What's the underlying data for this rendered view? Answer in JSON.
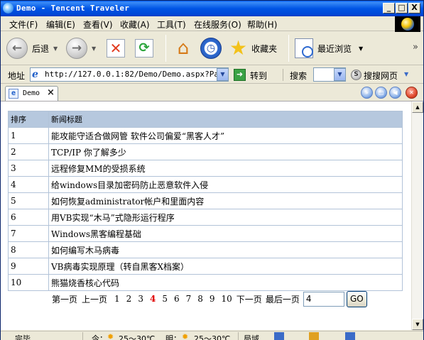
{
  "window": {
    "title": "Demo - Tencent Traveler",
    "min": "_",
    "max": "□",
    "close": "X"
  },
  "menu": [
    "文件(F)",
    "编辑(E)",
    "查看(V)",
    "收藏(A)",
    "工具(T)",
    "在线服务(O)",
    "帮助(H)"
  ],
  "toolbar": {
    "back": "后退",
    "favorites": "收藏夹",
    "recent": "最近浏览",
    "more": "»"
  },
  "address": {
    "label": "地址",
    "url": "http://127.0.0.1:82/Demo/Demo.aspx?PageN",
    "go": "转到",
    "search_label": "搜索",
    "search_web": "搜搜网页"
  },
  "tab": {
    "title": "Demo"
  },
  "grid": {
    "headers": [
      "排序",
      "新闻标题"
    ],
    "rows": [
      [
        "1",
        "能攻能守适合做网管 软件公司偏爱“黑客人才”"
      ],
      [
        "2",
        "TCP/IP 你了解多少"
      ],
      [
        "3",
        "远程修复MM的受损系统"
      ],
      [
        "4",
        "给windows目录加密码防止恶意软件入侵"
      ],
      [
        "5",
        "如何恢复administrator帐户和里面内容"
      ],
      [
        "6",
        "用VB实现“木马”式隐形运行程序"
      ],
      [
        "7",
        "Windows黑客编程基础"
      ],
      [
        "8",
        "如何编写木马病毒"
      ],
      [
        "9",
        "VB病毒实现原理（转自黑客X档案）"
      ],
      [
        "10",
        "熊猫烧香核心代码"
      ]
    ]
  },
  "pager": {
    "first": "第一页",
    "prev": "上一页",
    "pages": [
      "1",
      "2",
      "3",
      "4",
      "5",
      "6",
      "7",
      "8",
      "9",
      "10"
    ],
    "current": "4",
    "next": "下一页",
    "last": "最后一页",
    "input_value": "4",
    "go": "GO"
  },
  "status": [
    "完毕",
    "今：",
    "25～30℃",
    "明：",
    "25～30℃",
    "局域"
  ]
}
